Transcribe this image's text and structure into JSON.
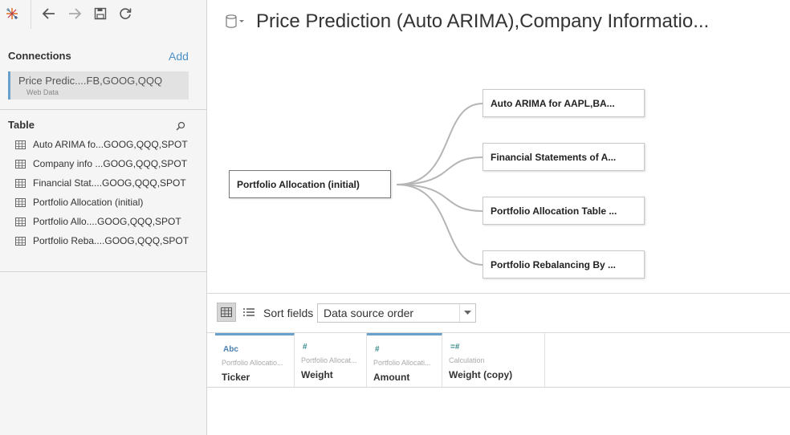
{
  "sidebar": {
    "connections_title": "Connections",
    "add_label": "Add",
    "connection": {
      "name": "Price Predic....FB,GOOG,QQQ",
      "type": "Web Data"
    },
    "table_title": "Table",
    "tables": [
      "Auto ARIMA fo...GOOG,QQQ,SPOT",
      "Company info ...GOOG,QQQ,SPOT",
      "Financial Stat....GOOG,QQQ,SPOT",
      "Portfolio Allocation (initial)",
      "Portfolio Allo....GOOG,QQQ,SPOT",
      "Portfolio Reba....GOOG,QQQ,SPOT"
    ]
  },
  "header": {
    "title": "Price Prediction (Auto ARIMA),Company Informatio..."
  },
  "canvas": {
    "root": "Portfolio Allocation (initial)",
    "children": [
      "Auto ARIMA for AAPL,BA...",
      "Financial Statements of A...",
      "Portfolio Allocation Table ...",
      "Portfolio Rebalancing By ..."
    ]
  },
  "grid_toolbar": {
    "sort_label": "Sort fields",
    "sort_value": "Data source order"
  },
  "columns": [
    {
      "type": "Abc",
      "source": "Portfolio Allocatio...",
      "name": "Ticker"
    },
    {
      "type": "#",
      "source": "Portfolio Allocat...",
      "name": "Weight"
    },
    {
      "type": "#",
      "source": "Portfolio Allocati...",
      "name": "Amount"
    },
    {
      "type": "=#",
      "source": "Calculation",
      "name": "Weight (copy)"
    }
  ],
  "colors": {
    "accent": "#6aa0cc",
    "link": "#4a90c8",
    "field_type": "#3a8a8a"
  }
}
